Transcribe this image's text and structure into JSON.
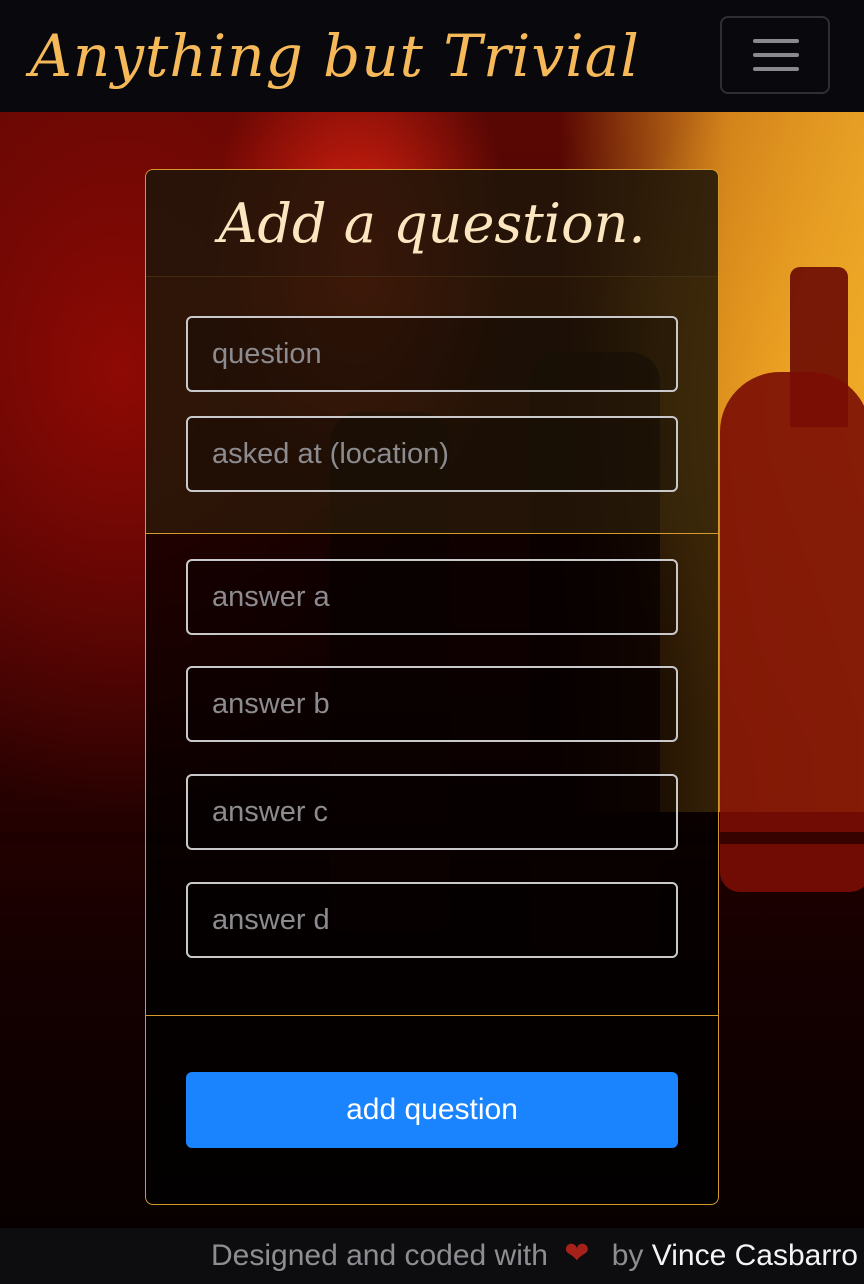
{
  "navbar": {
    "brand": "Anything but Trivial",
    "toggle_icon": "hamburger-menu-icon"
  },
  "form": {
    "title": "Add a question.",
    "question_placeholder": "question",
    "location_placeholder": "asked at (location)",
    "answer_a_placeholder": "answer a",
    "answer_b_placeholder": "answer b",
    "answer_c_placeholder": "answer c",
    "answer_d_placeholder": "answer d",
    "submit_label": "add question"
  },
  "footer": {
    "text_before": "Designed and coded with",
    "heart": "❤",
    "text_by": "by",
    "author": "Vince Casbarro"
  },
  "colors": {
    "brand": "#f5b95a",
    "card_border": "#d49a2c",
    "button": "#1a84ff",
    "heart": "#a6211a"
  }
}
